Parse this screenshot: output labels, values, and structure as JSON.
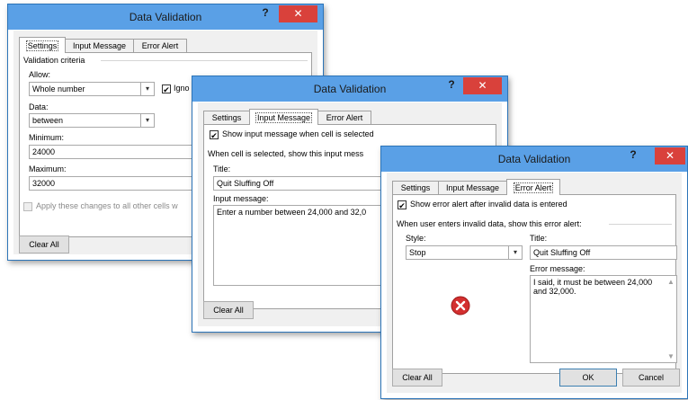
{
  "window_title": "Data Validation",
  "help_glyph": "?",
  "close_glyph": "✕",
  "tabs": {
    "settings": "Settings",
    "input_message": "Input Message",
    "error_alert": "Error Alert"
  },
  "clear_all": "Clear All",
  "settings_dialog": {
    "validation_criteria": "Validation criteria",
    "allow_label": "Allow:",
    "allow_value": "Whole number",
    "ignore_blank_label": "Igno",
    "ignore_blank_checked": true,
    "data_label": "Data:",
    "data_value": "between",
    "minimum_label": "Minimum:",
    "minimum_value": "24000",
    "maximum_label": "Maximum:",
    "maximum_value": "32000",
    "apply_all_label": "Apply these changes to all other cells w"
  },
  "input_dialog": {
    "show_input_label": "Show input message when cell is selected",
    "show_input_checked": true,
    "when_selected_label": "When cell is selected, show this input mess",
    "title_label": "Title:",
    "title_value": "Quit Sluffing Off",
    "input_message_label": "Input message:",
    "input_message_value": "Enter a number between 24,000 and 32,0"
  },
  "error_dialog": {
    "show_error_label": "Show error alert after invalid data is entered",
    "show_error_checked": true,
    "when_invalid_label": "When user enters invalid data, show this error alert:",
    "style_label": "Style:",
    "style_value": "Stop",
    "title_label": "Title:",
    "title_value": "Quit Sluffing Off",
    "error_message_label": "Error message:",
    "error_message_value": "I said, it must be between 24,000 and 32,000.",
    "ok_label": "OK",
    "cancel_label": "Cancel"
  },
  "colors": {
    "titlebar": "#5aa0e6",
    "close": "#d9413b",
    "stop_icon": "#d32f2f"
  }
}
